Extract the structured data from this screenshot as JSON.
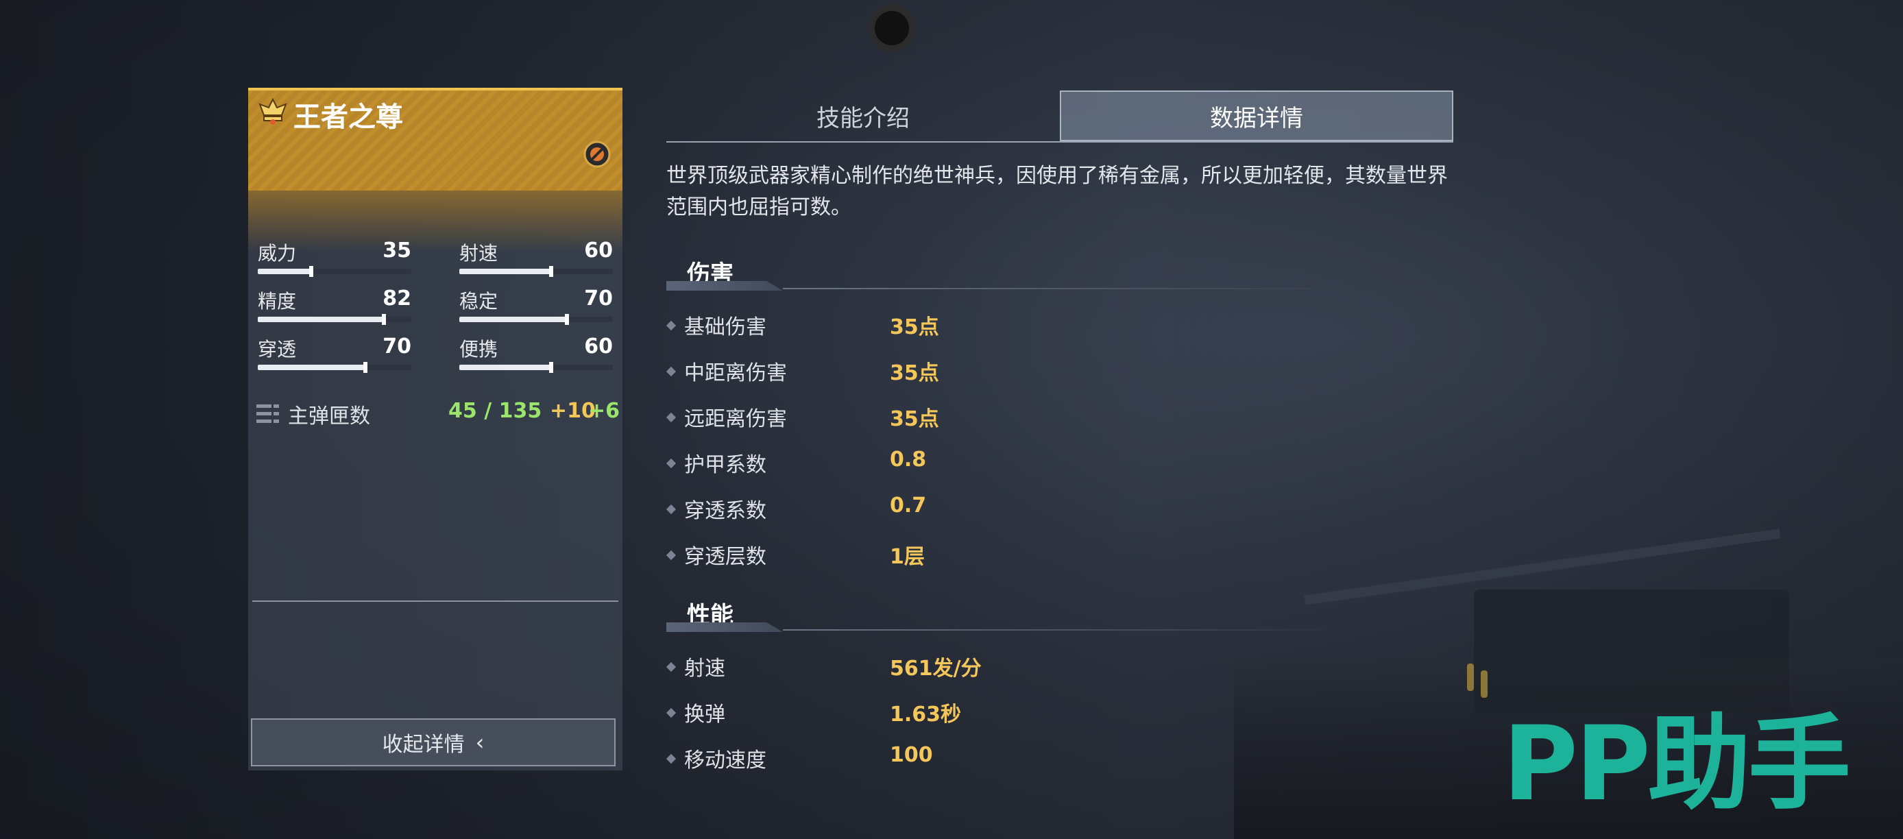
{
  "weapon": {
    "name": "王者之尊",
    "stats": [
      {
        "label": "威力",
        "value": "35",
        "fill": 0.35
      },
      {
        "label": "射速",
        "value": "60",
        "fill": 0.6
      },
      {
        "label": "精度",
        "value": "82",
        "fill": 0.82
      },
      {
        "label": "稳定",
        "value": "70",
        "fill": 0.7
      },
      {
        "label": "穿透",
        "value": "70",
        "fill": 0.7
      },
      {
        "label": "便携",
        "value": "60",
        "fill": 0.6
      }
    ],
    "ammo": {
      "label": "主弹匣数",
      "count": "45 / 135",
      "bonus_a": "+10",
      "bonus_b": "+6"
    },
    "collapse_label": "收起详情"
  },
  "tabs": {
    "skill": "技能介绍",
    "data": "数据详情",
    "active": "data"
  },
  "description": "世界顶级武器家精心制作的绝世神兵，因使用了稀有金属，所以更加轻便，其数量世界范围内也屈指可数。",
  "sections": {
    "damage": {
      "title": "伤害",
      "rows": [
        {
          "label": "基础伤害",
          "value": "35点"
        },
        {
          "label": "中距离伤害",
          "value": "35点"
        },
        {
          "label": "远距离伤害",
          "value": "35点"
        },
        {
          "label": "护甲系数",
          "value": "0.8"
        },
        {
          "label": "穿透系数",
          "value": "0.7"
        },
        {
          "label": "穿透层数",
          "value": "1层"
        }
      ]
    },
    "performance": {
      "title": "性能",
      "rows": [
        {
          "label": "射速",
          "value": "561发/分"
        },
        {
          "label": "换弹",
          "value": "1.63秒"
        },
        {
          "label": "移动速度",
          "value": "100"
        }
      ]
    }
  },
  "watermark": "PP助手",
  "colors": {
    "gold": "#f5c65a",
    "green": "#9be56a",
    "header": "#c18e2c",
    "watermark": "#1db39a"
  }
}
